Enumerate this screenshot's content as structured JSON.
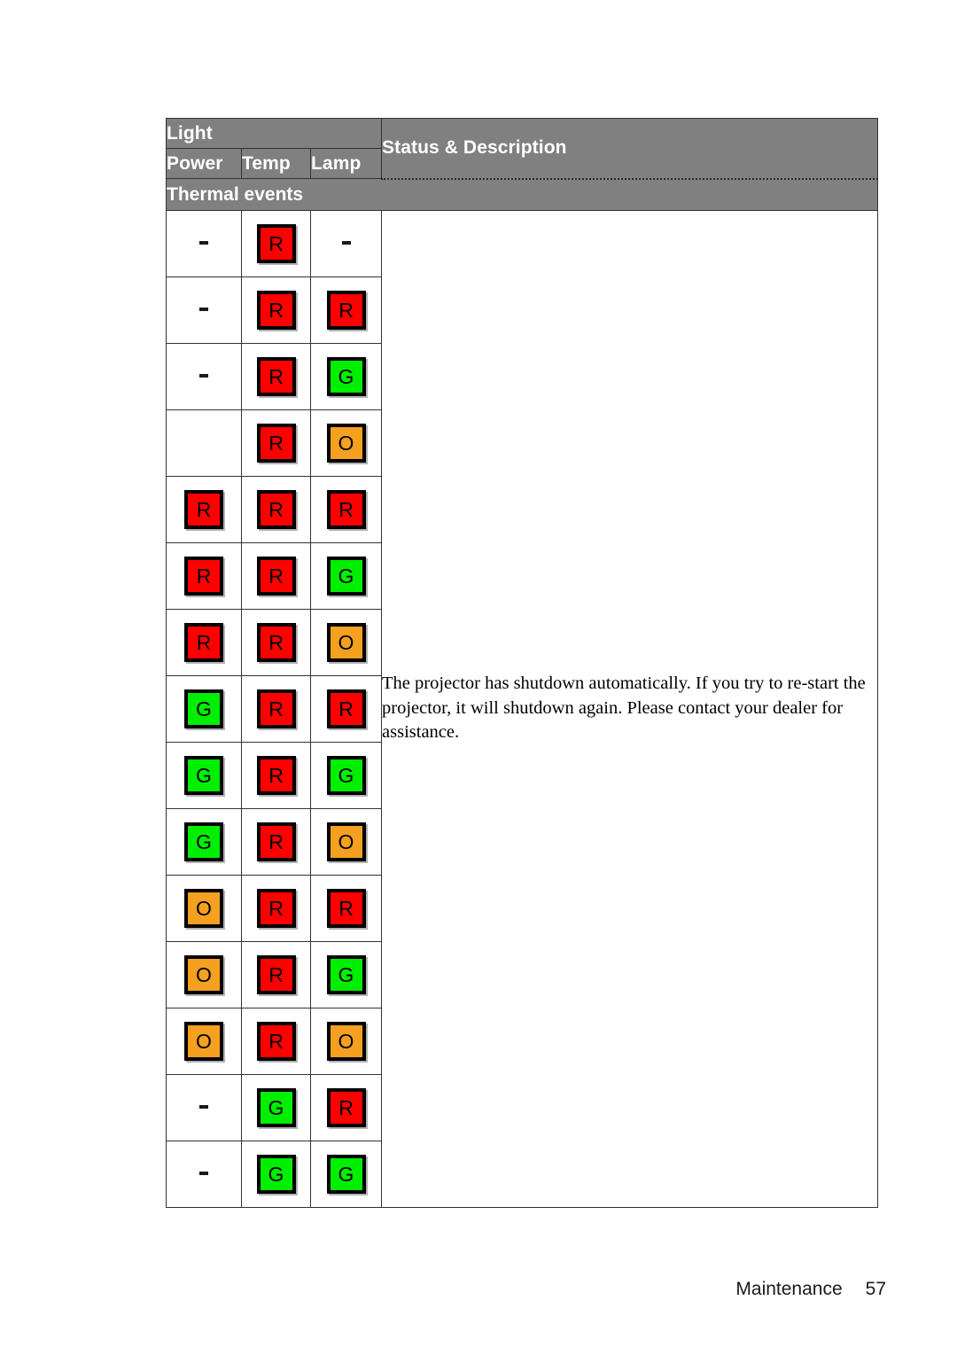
{
  "page": {
    "footer_label": "Maintenance",
    "footer_page_number": "57"
  },
  "table": {
    "header": {
      "light": "Light",
      "status": "Status & Description",
      "power": "Power",
      "temp": "Temp",
      "lamp": "Lamp"
    },
    "section_title": "Thermal events",
    "description": "The projector has shutdown automatically. If you try to re-start the projector, it will shutdown again. Please contact your dealer for assistance.",
    "legend": {
      "R": "Red",
      "G": "Green",
      "O": "Orange",
      "-": "Off"
    },
    "colors": {
      "red": "#ff0000",
      "green": "#00ee00",
      "orange": "#f5a020",
      "header_gray": "#808080",
      "border": "#333333",
      "text_white": "#ffffff",
      "text_black": "#000000"
    },
    "rows": [
      {
        "power": "-",
        "temp": "R",
        "lamp": "-"
      },
      {
        "power": "-",
        "temp": "R",
        "lamp": "R"
      },
      {
        "power": "-",
        "temp": "R",
        "lamp": "G"
      },
      {
        "power": "",
        "temp": "R",
        "lamp": "O"
      },
      {
        "power": "R",
        "temp": "R",
        "lamp": "R"
      },
      {
        "power": "R",
        "temp": "R",
        "lamp": "G"
      },
      {
        "power": "R",
        "temp": "R",
        "lamp": "O"
      },
      {
        "power": "G",
        "temp": "R",
        "lamp": "R"
      },
      {
        "power": "G",
        "temp": "R",
        "lamp": "G"
      },
      {
        "power": "G",
        "temp": "R",
        "lamp": "O"
      },
      {
        "power": "O",
        "temp": "R",
        "lamp": "R"
      },
      {
        "power": "O",
        "temp": "R",
        "lamp": "G"
      },
      {
        "power": "O",
        "temp": "R",
        "lamp": "O"
      },
      {
        "power": "-",
        "temp": "G",
        "lamp": "R"
      },
      {
        "power": "-",
        "temp": "G",
        "lamp": "G"
      }
    ]
  }
}
